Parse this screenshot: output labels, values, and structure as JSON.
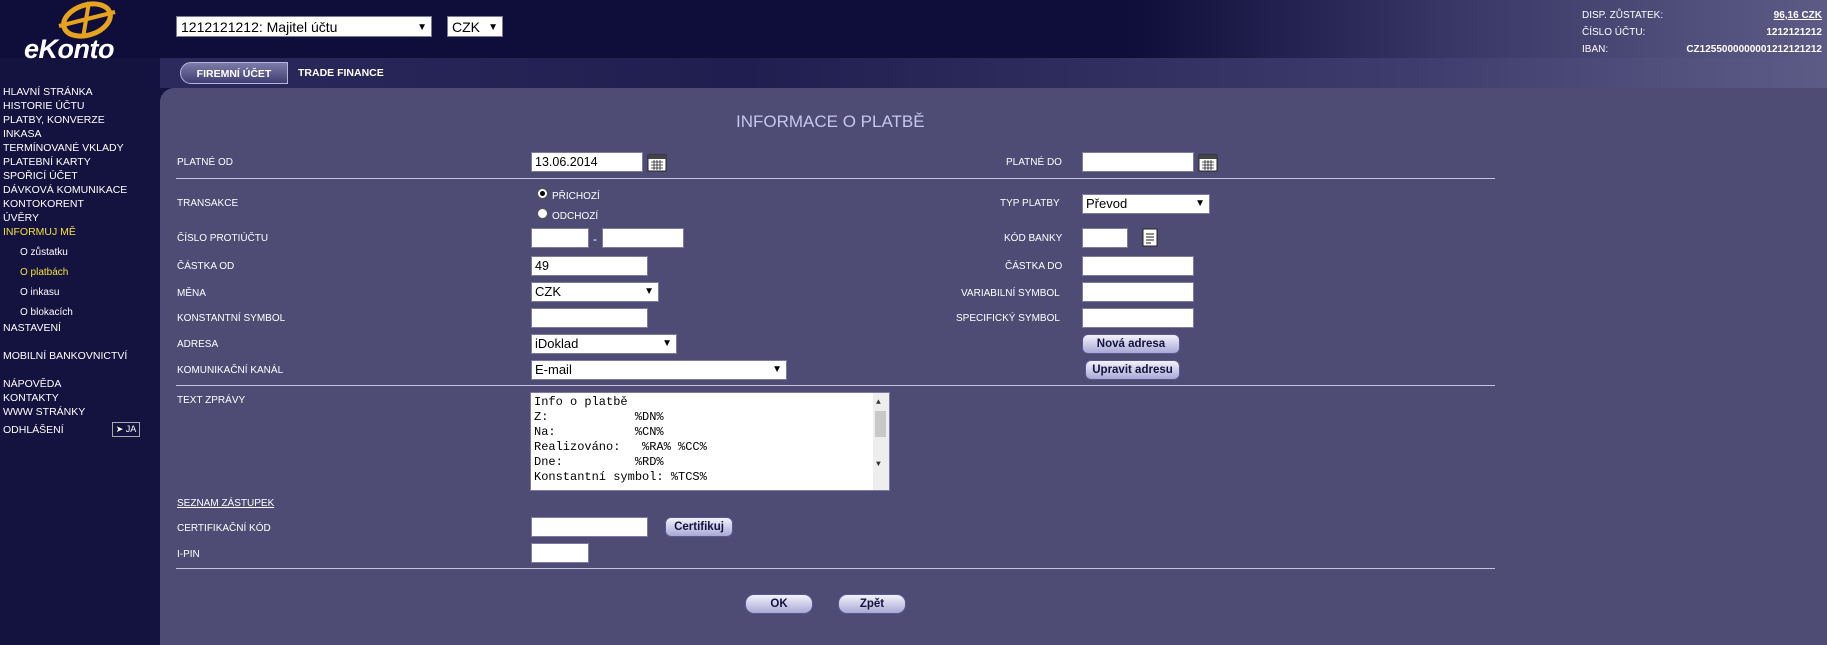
{
  "brand": {
    "logo_text": "eKonto"
  },
  "header": {
    "account_select": "1212121212: Majitel účtu",
    "currency_select": "CZK",
    "info": [
      {
        "label": "DISP. ZŮSTATEK:",
        "value": "96,16 CZK"
      },
      {
        "label": "ČÍSLO ÚČTU:",
        "value": "1212121212"
      },
      {
        "label": "IBAN:",
        "value": "CZ1255000000001212121212"
      }
    ]
  },
  "tabs": [
    {
      "label": "FIREMNÍ ÚČET"
    },
    {
      "label": "TRADE FINANCE"
    }
  ],
  "nav": {
    "items": [
      "HLAVNÍ STRÁNKA",
      "HISTORIE ÚČTU",
      "PLATBY, KONVERZE",
      "INKASA",
      "TERMÍNOVANÉ VKLADY",
      "PLATEBNÍ KARTY",
      "SPOŘICÍ ÚČET",
      "DÁVKOVÁ KOMUNIKACE",
      "KONTOKORENT",
      "ÚVĚRY",
      "INFORMUJ MĚ"
    ],
    "subitems": [
      "O zůstatku",
      "O platbách",
      "O inkasu",
      "O blokacích"
    ],
    "bottom": [
      "NASTAVENÍ",
      "MOBILNÍ BANKOVNICTVÍ",
      "NÁPOVĚDA",
      "KONTAKTY",
      "WWW STRÁNKY",
      "ODHLÁŠENÍ"
    ],
    "ja_label": "➤ JA"
  },
  "form": {
    "title": "INFORMACE O PLATBĚ",
    "platne_od_label": "PLATNÉ OD",
    "platne_od_value": "13.06.2014",
    "platne_do_label": "PLATNÉ DO",
    "platne_do_value": "",
    "transakce_label": "TRANSAKCE",
    "radio_in": "PŘICHOZÍ",
    "radio_out": "ODCHOZÍ",
    "typ_platby_label": "TYP PLATBY",
    "typ_platby_value": "Převod",
    "cislo_protiuctu_label": "ČÍSLO PROTIÚČTU",
    "dash": "-",
    "kod_banky_label": "KÓD BANKY",
    "castka_od_label": "ČÁSTKA OD",
    "castka_od_value": "49",
    "castka_do_label": "ČÁSTKA DO",
    "mena_label": "MĚNA",
    "mena_value": "CZK",
    "variabilni_label": "VARIABILNÍ SYMBOL",
    "konstantni_label": "KONSTANTNÍ SYMBOL",
    "specificky_label": "SPECIFICKÝ SYMBOL",
    "adresa_label": "ADRESA",
    "adresa_value": "iDoklad",
    "nova_adresa_btn": "Nová adresa",
    "kanal_label": "KOMUNIKAČNÍ KANÁL",
    "kanal_value": "E-mail",
    "upravit_adresu_btn": "Upravit adresu",
    "text_zpravy_label": "TEXT ZPRÁVY",
    "message_lines": [
      "Info o platbě",
      "Z:            %DN%",
      "Na:           %CN%",
      "Realizováno:   %RA% %CC%",
      "Dne:          %RD%",
      "Konstantní symbol: %TCS%"
    ],
    "seznam_label": "SEZNAM ZÁSTUPEK",
    "cert_label": "CERTIFIKAČNÍ KÓD",
    "cert_btn": "Certifikuj",
    "ipin_label": "I-PIN",
    "ok_btn": "OK",
    "back_btn": "Zpět"
  }
}
